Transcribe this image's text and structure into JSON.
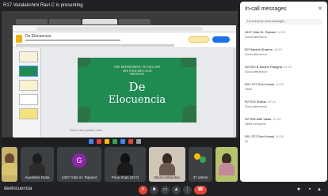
{
  "presenting": "R17 Varalakshmi Ravi C is presenting",
  "slides_app": {
    "doc_title": "De Elocuencia",
    "notes_placeholder": "Click to add speaker notes"
  },
  "slide": {
    "header_lines": [
      "THE DEPARTMENT OF ENGLISH",
      "THE ENGLISH CLUB",
      "PRESENTS"
    ],
    "title_1": "De",
    "title_2": "Elocuencia",
    "bg_color": "#1f8a52"
  },
  "participants": [
    {
      "name": "Ayesha Firdaus",
      "type": "video"
    },
    {
      "name": "Ayushree Dutta",
      "type": "video"
    },
    {
      "name": "2407 Gitta Sr. Rajnant",
      "type": "avatar",
      "initial": "G",
      "color": "#8e24aa"
    },
    {
      "name": "Priya Shah (R17)",
      "type": "video"
    },
    {
      "name": "Bhumi Bhandari",
      "type": "video"
    },
    {
      "name": "37 others",
      "type": "more"
    },
    {
      "name": "You",
      "type": "video"
    }
  ],
  "controls": {
    "meeting_name": "deelocuencia",
    "mic_icon": "mic-off-icon",
    "cam_icon": "camera-icon",
    "cc_icon": "captions-icon",
    "present_icon": "present-icon",
    "more_icon": "more-options-icon",
    "end_icon": "end-call-icon"
  },
  "chat": {
    "title": "In-call messages",
    "note": "Let everyone send messages",
    "messages": [
      {
        "sender": "2407 Gitta Sr. Rajnant",
        "time": "10:23",
        "text": "Good afternoon"
      },
      {
        "sender": "R2 Rakshit Sharma",
        "time": "10:23",
        "text": "Good afternoon"
      },
      {
        "sender": "R2 R20 B Sindhu Patagna",
        "time": "10:23",
        "text": "Good afternoon"
      },
      {
        "sender": "R01 S72 Devi Kamal",
        "time": "10:23",
        "text": "Hello"
      },
      {
        "sender": "R2 R33 Shikha",
        "time": "10:24",
        "text": "Good afternoon"
      },
      {
        "sender": "R2 R06 Aditi Vadia",
        "time": "10:24",
        "text": "Hello everyone"
      },
      {
        "sender": "R01 S72 Devi Kamal",
        "time": "10:25",
        "text": "Hi"
      }
    ]
  }
}
